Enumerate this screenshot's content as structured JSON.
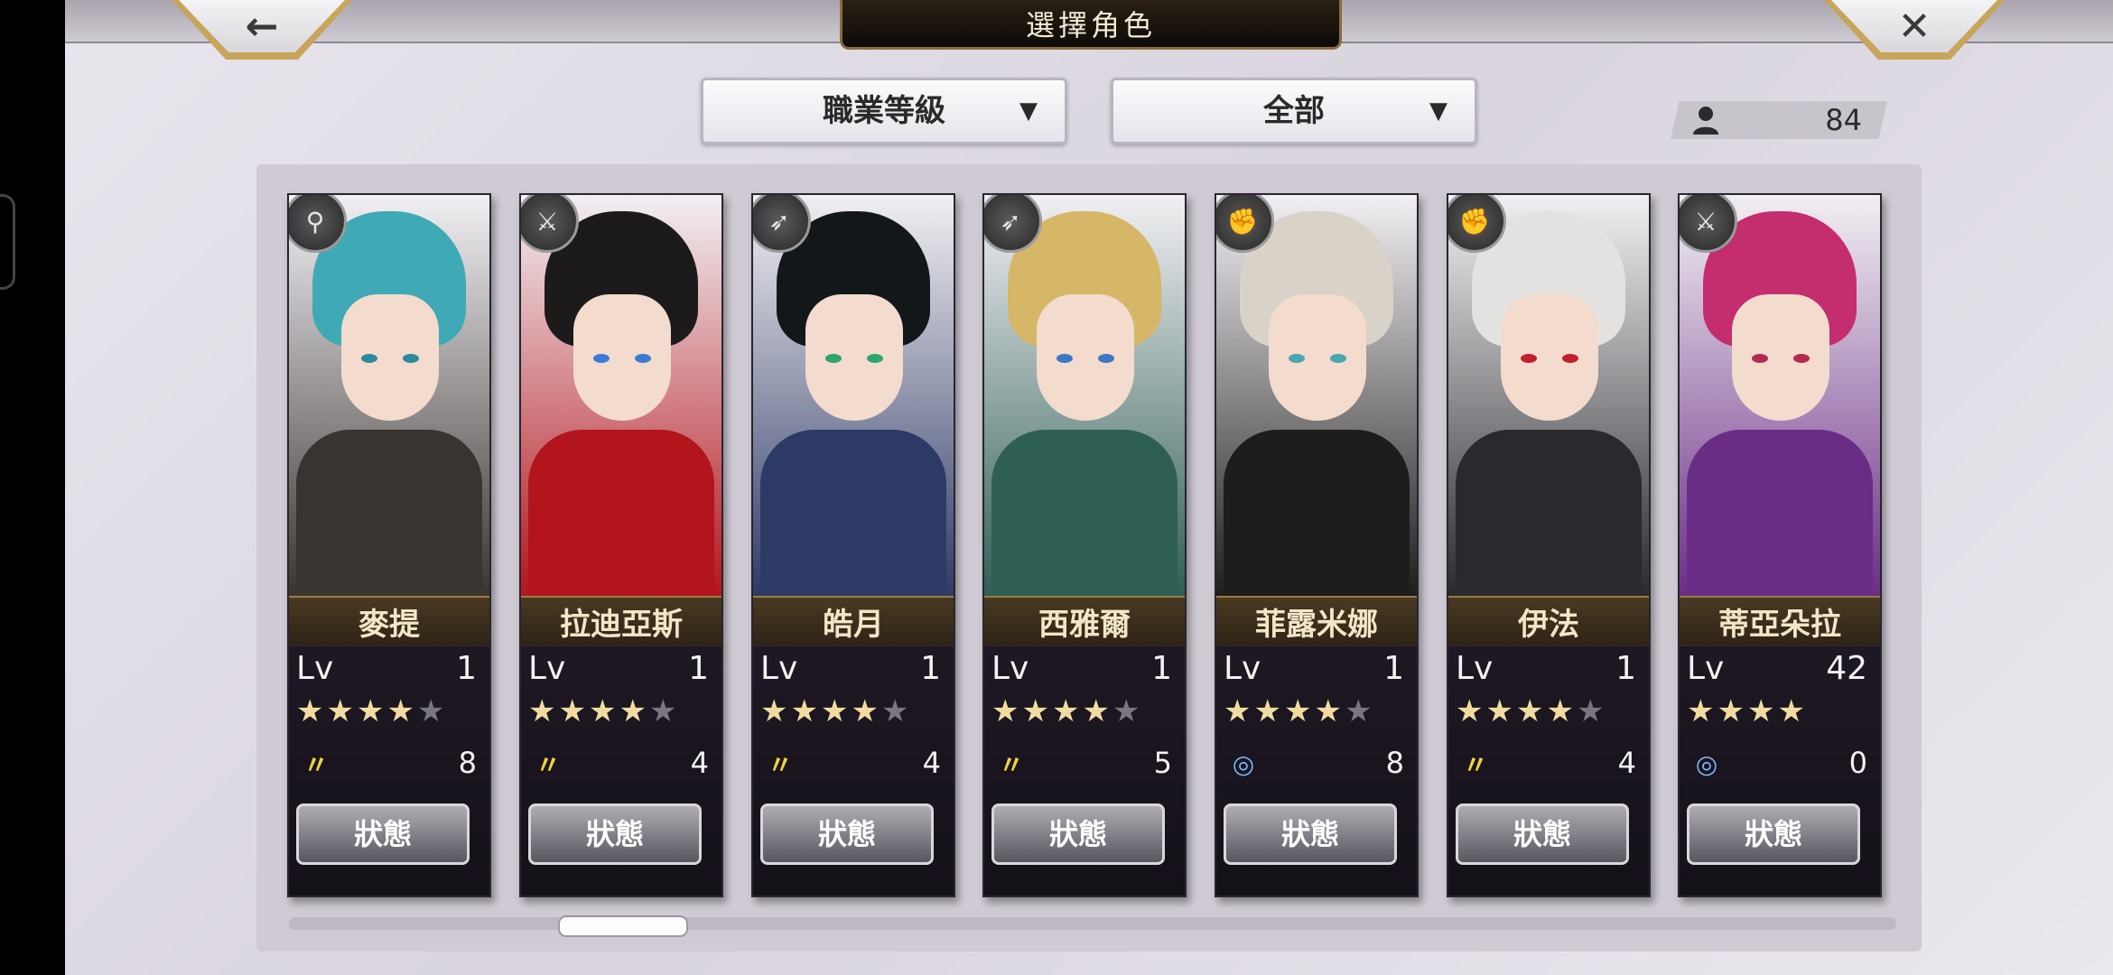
{
  "header": {
    "title": "選擇角色",
    "back_glyph": "←",
    "close_glyph": "✕"
  },
  "filters": {
    "sort_label": "職業等級",
    "filter_label": "全部",
    "arrow": "▼"
  },
  "roster": {
    "count": "84",
    "icon": "person-icon"
  },
  "colors": {
    "accent_gold": "#c7a55a",
    "star_on": "#f0dca0",
    "star_off": "#7a7680"
  },
  "characters": [
    {
      "name": "麥提",
      "lv_label": "Lv",
      "level": "1",
      "stars": 4,
      "max_stars": 5,
      "element": "wind",
      "element_count": "8",
      "status": "狀態",
      "class_icon": "staff-icon",
      "class_glyph": "⚲",
      "hair": "#3fa9b5",
      "body": "#3a3431",
      "eye": "#2d8a9a"
    },
    {
      "name": "拉迪亞斯",
      "lv_label": "Lv",
      "level": "1",
      "stars": 4,
      "max_stars": 5,
      "element": "wind",
      "element_count": "4",
      "status": "狀態",
      "class_icon": "sword-icon",
      "class_glyph": "⚔",
      "hair": "#1d1a1c",
      "body": "#b3151d",
      "eye": "#3b7bd6"
    },
    {
      "name": "皓月",
      "lv_label": "Lv",
      "level": "1",
      "stars": 4,
      "max_stars": 5,
      "element": "wind",
      "element_count": "4",
      "status": "狀態",
      "class_icon": "bow-icon",
      "class_glyph": "➶",
      "hair": "#12181a",
      "body": "#2e3a66",
      "eye": "#2fa46d"
    },
    {
      "name": "西雅爾",
      "lv_label": "Lv",
      "level": "1",
      "stars": 4,
      "max_stars": 5,
      "element": "wind",
      "element_count": "5",
      "status": "狀態",
      "class_icon": "bow-icon",
      "class_glyph": "➶",
      "hair": "#d6b768",
      "body": "#2f5e55",
      "eye": "#3c78c4"
    },
    {
      "name": "菲露米娜",
      "lv_label": "Lv",
      "level": "1",
      "stars": 4,
      "max_stars": 5,
      "element": "water",
      "element_count": "8",
      "status": "狀態",
      "class_icon": "gauntlet-icon",
      "class_glyph": "✊",
      "hair": "#d9d2c8",
      "body": "#1f1c1c",
      "eye": "#4aa7b0"
    },
    {
      "name": "伊法",
      "lv_label": "Lv",
      "level": "1",
      "stars": 4,
      "max_stars": 5,
      "element": "wind",
      "element_count": "4",
      "status": "狀態",
      "class_icon": "gauntlet-icon",
      "class_glyph": "✊",
      "hair": "#e4e2e0",
      "body": "#2a2a2e",
      "eye": "#c2202c"
    },
    {
      "name": "蒂亞朵拉",
      "lv_label": "Lv",
      "level": "42",
      "stars": 4,
      "max_stars": 4,
      "element": "water",
      "element_count": "0",
      "status": "狀態",
      "class_icon": "sword-icon",
      "class_glyph": "⚔",
      "hair": "#c42d6e",
      "body": "#6a2d86",
      "eye": "#b32a52"
    }
  ]
}
